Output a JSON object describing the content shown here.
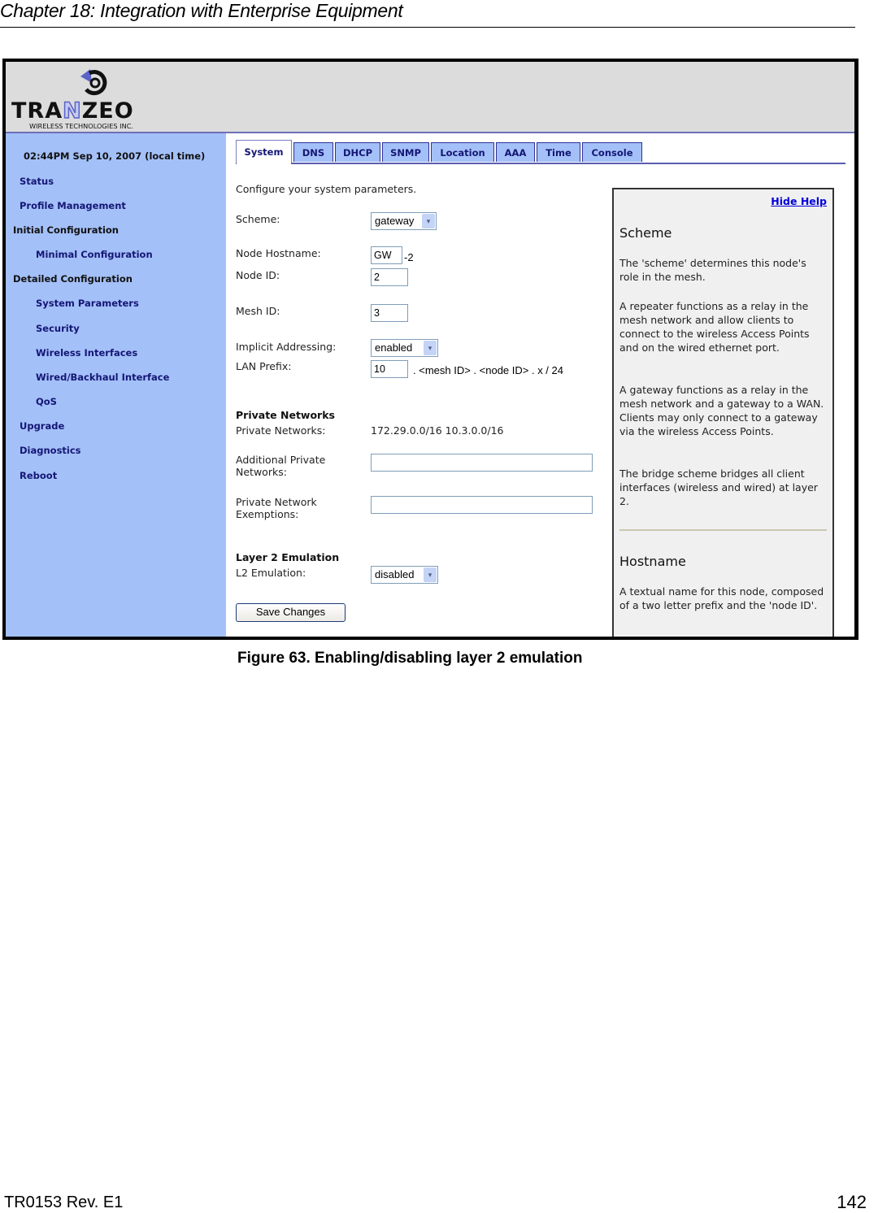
{
  "document": {
    "header": "Chapter 18: Integration with Enterprise Equipment",
    "caption": "Figure 63. Enabling/disabling layer 2 emulation",
    "footer_left": "TR0153 Rev. E1",
    "page_number": "142"
  },
  "logo": {
    "name": "TRANZEO",
    "tagline": "WIRELESS  TECHNOLOGIES INC.",
    "colors": {
      "accent": "#5a63c8",
      "text": "#111111"
    }
  },
  "sidebar": {
    "clock": "02:44PM Sep 10, 2007 (local time)",
    "items": [
      {
        "label": "Status",
        "type": "link"
      },
      {
        "label": "Profile Management",
        "type": "link"
      },
      {
        "label": "Initial Configuration",
        "type": "group"
      },
      {
        "label": "Minimal Configuration",
        "type": "sublink"
      },
      {
        "label": "Detailed Configuration",
        "type": "group"
      },
      {
        "label": "System Parameters",
        "type": "sublink"
      },
      {
        "label": "Security",
        "type": "sublink"
      },
      {
        "label": "Wireless Interfaces",
        "type": "sublink"
      },
      {
        "label": "Wired/Backhaul Interface",
        "type": "sublink"
      },
      {
        "label": "QoS",
        "type": "sublink"
      },
      {
        "label": "Upgrade",
        "type": "link"
      },
      {
        "label": "Diagnostics",
        "type": "link"
      },
      {
        "label": "Reboot",
        "type": "link"
      }
    ]
  },
  "tabs": [
    {
      "label": "System",
      "active": true
    },
    {
      "label": "DNS"
    },
    {
      "label": "DHCP"
    },
    {
      "label": "SNMP"
    },
    {
      "label": "Location"
    },
    {
      "label": "AAA"
    },
    {
      "label": "Time"
    },
    {
      "label": "Console"
    }
  ],
  "form": {
    "intro": "Configure your system parameters.",
    "scheme": {
      "label": "Scheme:",
      "value": "gateway"
    },
    "node_hostname": {
      "label": "Node Hostname:",
      "value": "GW",
      "suffix": "-2"
    },
    "node_id": {
      "label": "Node ID:",
      "value": "2"
    },
    "mesh_id": {
      "label": "Mesh ID:",
      "value": "3"
    },
    "implicit_addressing": {
      "label": "Implicit Addressing:",
      "value": "enabled"
    },
    "lan_prefix": {
      "label": "LAN Prefix:",
      "value": "10",
      "suffix": ". <mesh ID> . <node ID> . x / 24"
    },
    "private_networks_section": "Private Networks",
    "private_networks": {
      "label": "Private Networks:",
      "value": "172.29.0.0/16 10.3.0.0/16"
    },
    "additional_private": {
      "label_line1": "Additional Private",
      "label_line2": "Networks:",
      "value": ""
    },
    "exemptions": {
      "label_line1": "Private Network",
      "label_line2": "Exemptions:",
      "value": ""
    },
    "l2_section": "Layer 2 Emulation",
    "l2_emulation": {
      "label": "L2 Emulation:",
      "value": "disabled"
    },
    "save_label": "Save Changes"
  },
  "help": {
    "hide_label": "Hide Help",
    "scheme_title": "Scheme",
    "scheme_p1": "The 'scheme' determines this node's role in the mesh.",
    "scheme_p2": "A repeater functions as a relay in the mesh network and allow clients to connect to the wireless Access Points and on the wired ethernet port.",
    "scheme_p3": "A gateway functions as a relay in the mesh network and a gateway to a WAN. Clients may only connect to a gateway via the wireless Access Points.",
    "scheme_p4": "The bridge scheme bridges all client interfaces (wireless and wired) at layer 2.",
    "hostname_title": "Hostname",
    "hostname_p1": "A textual name for this node, composed of a two letter prefix and the 'node ID'."
  },
  "icons": {
    "dropdown_arrow": "▾"
  }
}
